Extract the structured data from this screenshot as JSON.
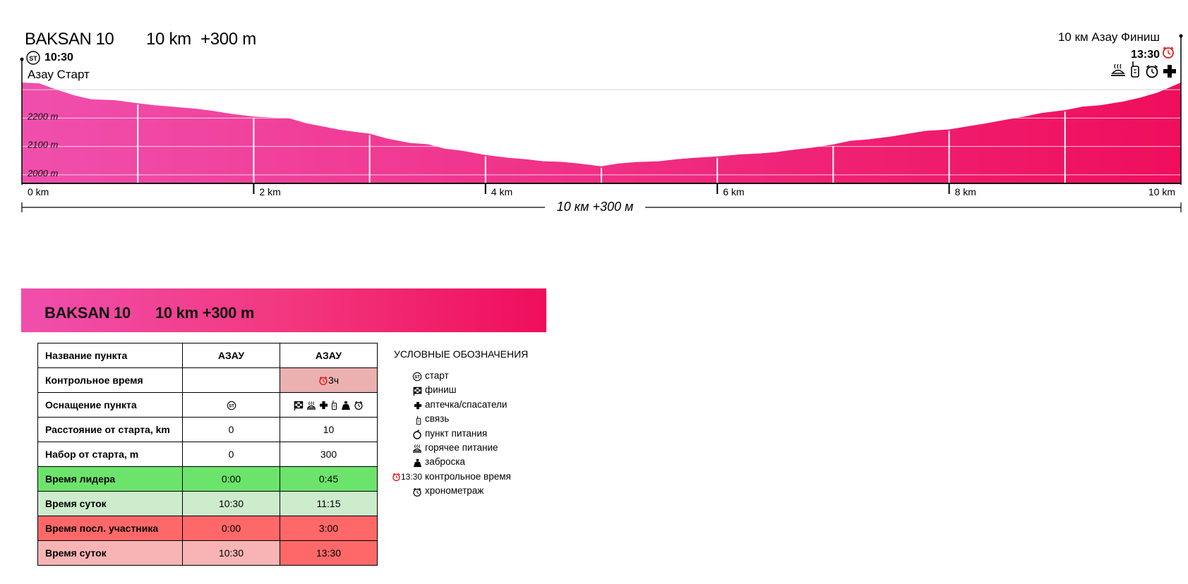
{
  "header": {
    "race_name": "BAKSAN 10",
    "distance": "10 km",
    "gain": "+300 m",
    "start_time": "10:30",
    "start_name": "Азау Старт",
    "finish_label": "10 км Азау Финиш",
    "finish_time": "13:30"
  },
  "total_label": "10 км +300 м",
  "chart_data": {
    "type": "area",
    "x_unit": "km",
    "y_unit": "m",
    "xlim": [
      0,
      10
    ],
    "ylim": [
      1970,
      2330
    ],
    "x_tick_labels": [
      "0 km",
      "2 km",
      "4 km",
      "6 km",
      "8 km",
      "10 km"
    ],
    "x_ticks": [
      0,
      2,
      4,
      6,
      8,
      10
    ],
    "y_tick_labels": [
      "2000 m",
      "2100 m",
      "2200 m"
    ],
    "y_ticks": [
      2000,
      2100,
      2200
    ],
    "grid": true,
    "fill_gradient": [
      "#f04fad",
      "#ef0e5c"
    ],
    "x": [
      0,
      0.15,
      0.3,
      0.45,
      0.6,
      0.8,
      1.0,
      1.15,
      1.3,
      1.5,
      1.65,
      1.8,
      2.0,
      2.15,
      2.3,
      2.45,
      2.6,
      2.75,
      2.9,
      3.0,
      3.15,
      3.35,
      3.5,
      3.65,
      3.8,
      4.0,
      4.2,
      4.35,
      4.5,
      4.65,
      4.8,
      5.0,
      5.15,
      5.3,
      5.5,
      5.65,
      5.8,
      6.0,
      6.2,
      6.35,
      6.5,
      6.65,
      6.8,
      7.0,
      7.15,
      7.3,
      7.5,
      7.65,
      7.8,
      8.0,
      8.15,
      8.3,
      8.5,
      8.65,
      8.8,
      9.0,
      9.15,
      9.3,
      9.5,
      9.65,
      9.8,
      10.0
    ],
    "y": [
      2325,
      2322,
      2300,
      2280,
      2266,
      2263,
      2252,
      2245,
      2240,
      2233,
      2225,
      2215,
      2205,
      2202,
      2200,
      2182,
      2170,
      2158,
      2150,
      2145,
      2128,
      2112,
      2108,
      2092,
      2085,
      2070,
      2060,
      2055,
      2048,
      2046,
      2040,
      2030,
      2040,
      2045,
      2048,
      2055,
      2060,
      2065,
      2072,
      2075,
      2080,
      2088,
      2095,
      2107,
      2120,
      2125,
      2135,
      2145,
      2155,
      2160,
      2170,
      2180,
      2195,
      2205,
      2218,
      2228,
      2240,
      2245,
      2258,
      2272,
      2290,
      2325
    ]
  },
  "banner": {
    "name": "BAKSAN 10",
    "distance_gain": "10 km +300 m"
  },
  "table": {
    "header": {
      "label": "Название пункта",
      "col1": "АЗАУ",
      "col2": "АЗАУ"
    },
    "rows": [
      {
        "label": "Контрольное время",
        "col1": "",
        "col2": "3ч"
      },
      {
        "label": "Оснащение пункта",
        "col1_icons": [
          "start-icon"
        ],
        "col2_icons": [
          "finish-flag-icon",
          "hot-food-icon",
          "first-aid-icon",
          "radio-icon",
          "dropbag-icon",
          "timing-icon"
        ]
      },
      {
        "label": "Расстояние от старта, km",
        "col1": "0",
        "col2": "10"
      },
      {
        "label": "Набор от старта, m",
        "col1": "0",
        "col2": "300"
      },
      {
        "label": "Время лидера",
        "col1": "0:00",
        "col2": "0:45"
      },
      {
        "label": "Время суток",
        "col1": "10:30",
        "col2": "11:15"
      },
      {
        "label": "Время посл. участника",
        "col1": "0:00",
        "col2": "3:00"
      },
      {
        "label": "Время суток",
        "col1": "10:30",
        "col2": "13:30"
      }
    ]
  },
  "legend": {
    "title": "УСЛОВНЫЕ ОБОЗНАЧЕНИЯ",
    "items": [
      {
        "icon": "start-icon",
        "label": "старт"
      },
      {
        "icon": "finish-flag-icon",
        "label": "финиш"
      },
      {
        "icon": "first-aid-icon",
        "label": "аптечка/спасатели"
      },
      {
        "icon": "radio-icon",
        "label": "связь"
      },
      {
        "icon": "food-icon",
        "label": "пункт питания"
      },
      {
        "icon": "hot-food-icon",
        "label": "горячее питание"
      },
      {
        "icon": "dropbag-icon",
        "label": "заброска"
      },
      {
        "icon": "cutoff-clock-icon",
        "label": "контрольное время",
        "prefix": "13:30"
      },
      {
        "icon": "timing-icon",
        "label": "хронометраж"
      }
    ]
  },
  "colors": {
    "gradient_start": "#f04fad",
    "gradient_end": "#ef0e5c",
    "leader_row": "#6ce46b",
    "leader_day_row": "#cdeccc",
    "last_row": "#ff6868",
    "last_day_row": "#f8b4b4",
    "cutoff_cell": "#ebb0b0"
  }
}
